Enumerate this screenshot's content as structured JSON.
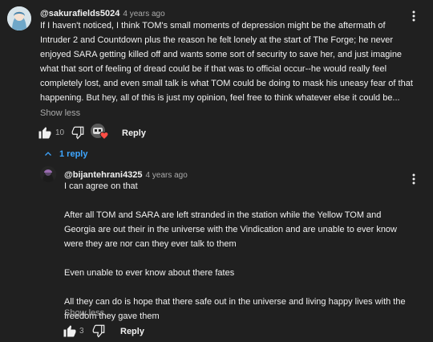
{
  "comment": {
    "handle": "@sakurafields5024",
    "time": "4 years ago",
    "text": "If I haven't noticed, I think TOM's small moments of depression might be the aftermath of Intruder 2 and Countdown plus the reason he felt lonely at the start of The Forge; he never enjoyed SARA getting killed off and wants some sort of security to save her, and just imagine what that sort of feeling of dread could be if that was to official occur--he would really feel completely lost, and even small talk is what TOM could be doing to mask his uneasy fear of that happening. But hey, all of this is just my opinion, feel free to think whatever else it could be...",
    "show_less": "Show less",
    "likes": "10",
    "reply_label": "Reply"
  },
  "replies_toggle": "1 reply",
  "reply": {
    "handle": "@bijantehrani4325",
    "time": "4 years ago",
    "paragraphs": [
      "I can agree on that",
      "After all TOM and SARA are left stranded in the station while the Yellow TOM and Georgia are out their in the universe with the Vindication and are unable to ever know were they are nor can they ever talk to them",
      "Even unable to ever know about there fates",
      "All they can do is hope that there safe out in the universe and living happy lives with the freedom they gave them"
    ],
    "show_less": "Show less",
    "likes": "3",
    "reply_label": "Reply"
  },
  "icons": {
    "like": "thumbs-up-icon",
    "dislike": "thumbs-down-icon",
    "menu": "more-vert-icon",
    "heart": "creator-heart-icon",
    "chevron": "chevron-up-icon"
  },
  "colors": {
    "background": "#202020",
    "text": "#f1f1f1",
    "secondary": "#aaaaaa",
    "link": "#3ea6ff",
    "heart": "#ff4e45"
  }
}
